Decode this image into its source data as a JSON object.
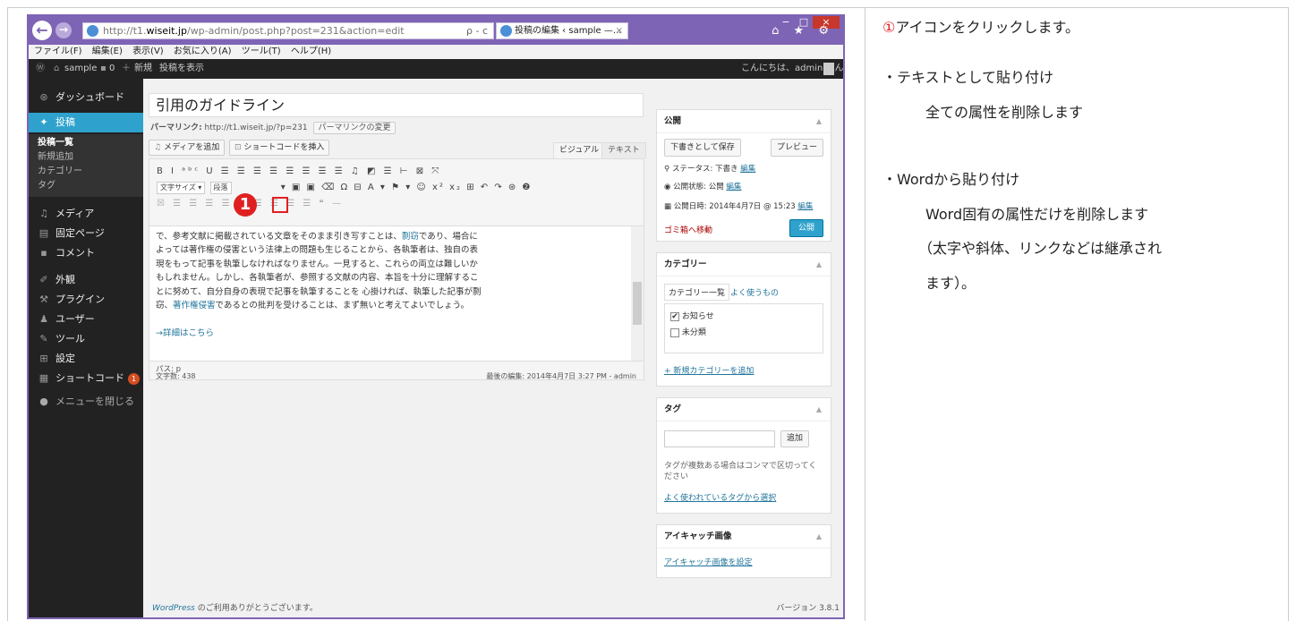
{
  "browser": {
    "url_prefix": "http://t1.",
    "url_domain": "wiseit.jp",
    "url_path": "/wp-admin/post.php?post=231&action=edit",
    "url_search": "ρ - c",
    "tab_title": "投稿の編集 ‹ sample —...",
    "tab_close": "×",
    "win_controls": [
      "−",
      "□",
      "×"
    ],
    "toolbar_icons": "⌂ ★ ⚙",
    "menus": [
      "ファイル(F)",
      "編集(E)",
      "表示(V)",
      "お気に入り(A)",
      "ツール(T)",
      "ヘルプ(H)"
    ]
  },
  "adminbar": {
    "site": "sample",
    "comments": "0",
    "new": "新規",
    "view": "投稿を表示",
    "greeting": "こんにちは、admin さん!"
  },
  "sidebar": {
    "items": [
      {
        "icon": "⊛",
        "label": "ダッシュボード"
      },
      {
        "icon": "✦",
        "label": "投稿"
      },
      {
        "icon": "♫",
        "label": "メディア"
      },
      {
        "icon": "▤",
        "label": "固定ページ"
      },
      {
        "icon": "▪",
        "label": "コメント"
      },
      {
        "icon": "✐",
        "label": "外観"
      },
      {
        "icon": "⚒",
        "label": "プラグイン"
      },
      {
        "icon": "♟",
        "label": "ユーザー"
      },
      {
        "icon": "✎",
        "label": "ツール"
      },
      {
        "icon": "⊞",
        "label": "設定"
      },
      {
        "icon": "▦",
        "label": "ショートコード"
      },
      {
        "icon": "●",
        "label": "メニューを閉じる"
      }
    ],
    "sub": [
      "投稿一覧",
      "新規追加",
      "カテゴリー",
      "タグ"
    ],
    "shortcode_badge": "1"
  },
  "editor": {
    "title": "引用のガイドライン",
    "permalink_label": "パーマリンク:",
    "permalink_url": "http://t1.wiseit.jp/?p=231",
    "permalink_btn": "パーマリンクの変更",
    "add_media": "メディアを追加",
    "insert_shortcode": "ショートコードを挿入",
    "tab_visual": "ビジュアル",
    "tab_text": "テキスト",
    "toolbar_row1": "B I ᵃᵇᶜ U ☰ ☰ ☰ ☰ ☰ ☰ ☰ ☰ ♫ ◩ ☰ ⊢ ⊠ ⤧",
    "toolbar_row2_sel1": "文字サイズ ▾",
    "toolbar_row2_sel2": "段落",
    "toolbar_row2_icons": "▾ ▣ ▣ ⌫ Ω ⊟ A ▾ ⚑ ▾ ☺ x² x₂ ⊞ ↶ ↷ ⊛ ❷",
    "toolbar_row3": "☒ ☰ ☰ ☰ ☰ ☰ ☰ ☰ ☰ ☰ ❝ —",
    "body_lines": [
      "で、参考文献に掲載されている文章をそのまま引き写すことは、",
      "よっては著作権の侵害という法律上の問題も生じることから、各執筆者は、独自の表",
      "現をもって記事を執筆しなければなりません。一見すると、これらの両立は難しいか",
      "もしれません。しかし、各執筆者が、参照する文献の内容、本旨を十分に理解するこ",
      "とに努めて、自分自身の表現で記事を執筆することを 心掛ければ、執筆した記事が剽",
      "窃、",
      "であるとの批判を受けることは、まず無いと考えてよいでしょう。"
    ],
    "link_plagiarism": "剽窃",
    "line1_tail": "であり、場合に",
    "link_copyright": "著作権侵害",
    "more_link": "→詳細はこちら",
    "path": "パス: p",
    "word_count": "文字数: 438",
    "last_edit": "最後の編集: 2014年4月7日 3:27 PM - admin"
  },
  "annotation": {
    "number": "1"
  },
  "publish": {
    "title": "公開",
    "save_draft": "下書きとして保存",
    "preview": "プレビュー",
    "status": "ステータス: 下書き",
    "status_edit": "編集",
    "visibility": "公開状態: 公開",
    "visibility_edit": "編集",
    "date": "公開日時: 2014年4月7日 @ 15:23",
    "date_edit": "編集",
    "trash": "ゴミ箱へ移動",
    "publish": "公開"
  },
  "category": {
    "title": "カテゴリー",
    "tab_all": "カテゴリー一覧",
    "tab_popular": "よく使うもの",
    "items": [
      {
        "label": "お知らせ",
        "checked": true
      },
      {
        "label": "未分類",
        "checked": false
      }
    ],
    "add_new": "+ 新規カテゴリーを追加"
  },
  "tags": {
    "title": "タグ",
    "input_value": "",
    "add_btn": "追加",
    "hint_1": "タグが複数ある場合はコンマで区切ってく",
    "hint_2": "ださい",
    "choose": "よく使われているタグから選択"
  },
  "thumbnail": {
    "title": "アイキャッチ画像",
    "set": "アイキャッチ画像を設定"
  },
  "footer": {
    "left_brand": "WordPress",
    "left_rest": " のご利用ありがとうございます。",
    "version": "バージョン 3.8.1"
  },
  "explanation": {
    "step_num": "①",
    "step_text": "アイコンをクリックします。",
    "bullet1": "・テキストとして貼り付け",
    "bullet1_desc": "全ての属性を削除します",
    "bullet2": "・Wordから貼り付け",
    "bullet2_desc": "Word固有の属性だけを削除します",
    "bullet2_note1": "（太字や斜体、リンクなどは継承され",
    "bullet2_note2": "ます）。"
  }
}
